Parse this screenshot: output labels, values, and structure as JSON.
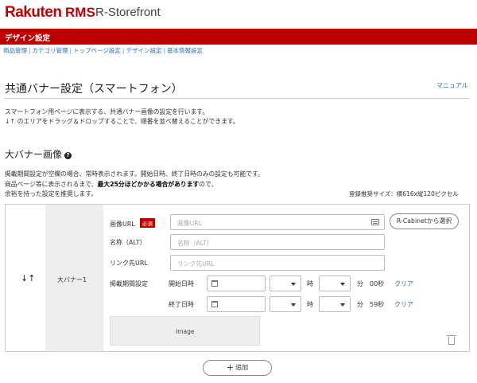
{
  "header": {
    "brand_rakuten": "Rakuten",
    "brand_rms": "RMS",
    "brand_sub": "R-Storefront",
    "brand_color": "#bf0000"
  },
  "redbar": {
    "title": "デザイン設定"
  },
  "breadcrumb": {
    "items": [
      "商品管理",
      "カテゴリ管理",
      "トップページ設定",
      "デザイン設定",
      "基本情報設定"
    ],
    "separator": "|"
  },
  "page": {
    "title": "共通バナー設定（スマートフォン）",
    "manual_link": "マニュアル",
    "desc_line1": "スマートフォン用ページに表示する、共通バナー画像の設定を行います。",
    "desc_line2": "のエリアをドラッグ＆ドロップすることで、順番を並べ替えることができます。",
    "drag_symbol": "↓↑"
  },
  "section": {
    "title": "大バナー画像",
    "help_icon": "?",
    "note_line1": "掲載期間設定が空欄の場合、常時表示されます。開始日時、終了日時のみの設定も可能です。",
    "note_line2_pre": "商品ページ等に表示されるまで、",
    "note_line2_bold": "最大25分ほどかかる場合があります",
    "note_line2_post": "ので、",
    "note_line3": "余裕を持った設定を推奨します。",
    "recommend_size": "登録推奨サイズ：横616x縦120ピクセル"
  },
  "banner": {
    "row_label": "大バナー1",
    "drag_icon": "↓↑",
    "image_url_label": "画像URL",
    "required_badge": "必須",
    "image_url_placeholder": "画像URL",
    "rcabinet_button": "R-Cabinetから選択",
    "alt_label": "名称（ALT）",
    "alt_placeholder": "名称（ALT）",
    "link_label": "リンク先URL",
    "link_placeholder": "リンク先URL",
    "period_label": "掲載期間設定",
    "start_label": "開始日時",
    "end_label": "終了日時",
    "hour_unit": "時",
    "minute_unit": "分",
    "start_seconds": "00秒",
    "end_seconds": "59秒",
    "clear_link": "クリア",
    "image_box_label": "Image"
  },
  "add_button": {
    "plus": "+",
    "label": "追加"
  }
}
